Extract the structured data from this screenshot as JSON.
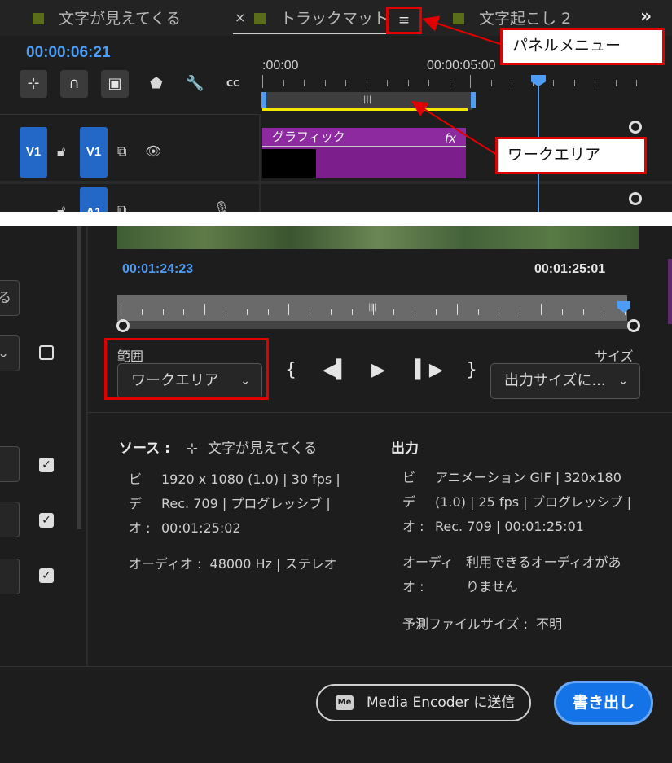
{
  "top_panel": {
    "tabs": [
      {
        "label": "文字が見えてくる",
        "close": ""
      },
      {
        "label": "トラックマット",
        "close": "×"
      },
      {
        "label": "文字起こし 2",
        "close": ""
      }
    ],
    "panel_menu_glyph": "≡",
    "overflow_glyph": "»",
    "timecode": "00:00:06:21",
    "ruler_start": ":00:00",
    "ruler_mid": "00:00:05:00",
    "clip_label": "グラフィック",
    "clip_fx": "fx",
    "track_v1_source": "V1",
    "track_v1_target": "V1",
    "track_a1_target": "A1",
    "toolbar_icons": [
      "insert-sequence-icon",
      "snap-icon",
      "linked-selection-icon",
      "add-marker-icon",
      "wrench-icon",
      "captions-icon"
    ],
    "captions_label": "CC"
  },
  "callouts": {
    "panel_menu": "パネルメニュー",
    "work_area": "ワークエリア"
  },
  "export_panel": {
    "sidebar_box_labels": [
      "る",
      "⌄"
    ],
    "timecode_in": "00:01:24:23",
    "timecode_out": "00:01:25:01",
    "range_label": "範囲",
    "range_value": "ワークエリア",
    "size_label": "サイズ",
    "size_value": "出力サイズに...",
    "transport": [
      "{",
      "◀▍",
      "▶",
      "▍▶",
      "}"
    ],
    "source": {
      "heading": "ソース :",
      "name": "文字が見えてくる",
      "video_key": "ビ",
      "video_val": "1920 x 1080 (1.0) | 30 fps |",
      "de_key": "デ",
      "de_val": "Rec. 709 | プログレッシブ |",
      "o_key": "オ :",
      "o_val": "00:01:25:02",
      "audio_key": "オーディオ :",
      "audio_val": "48000 Hz | ステレオ"
    },
    "output": {
      "heading": "出力",
      "video_key": "ビ",
      "video_val": "アニメーション GIF | 320x180",
      "de_key": "デ",
      "de_val": "(1.0) | 25 fps | プログレッシブ |",
      "o_key": "オ :",
      "o_val": "Rec. 709 | 00:01:25:01",
      "audio_key_1": "オーディ",
      "audio_key_2": "オ :",
      "audio_val_1": "利用できるオーディオがあ",
      "audio_val_2": "りません",
      "filesize_key": "予測ファイルサイズ :",
      "filesize_val": "不明"
    },
    "media_encoder_logo": "Me",
    "media_encoder_button": "Media Encoder に送信",
    "export_button": "書き出し"
  },
  "colors": {
    "accent_blue": "#4f9cf5",
    "highlight_red": "#e00000",
    "clip_purple": "#7c1f8c",
    "work_area_yellow": "#f3e600"
  }
}
